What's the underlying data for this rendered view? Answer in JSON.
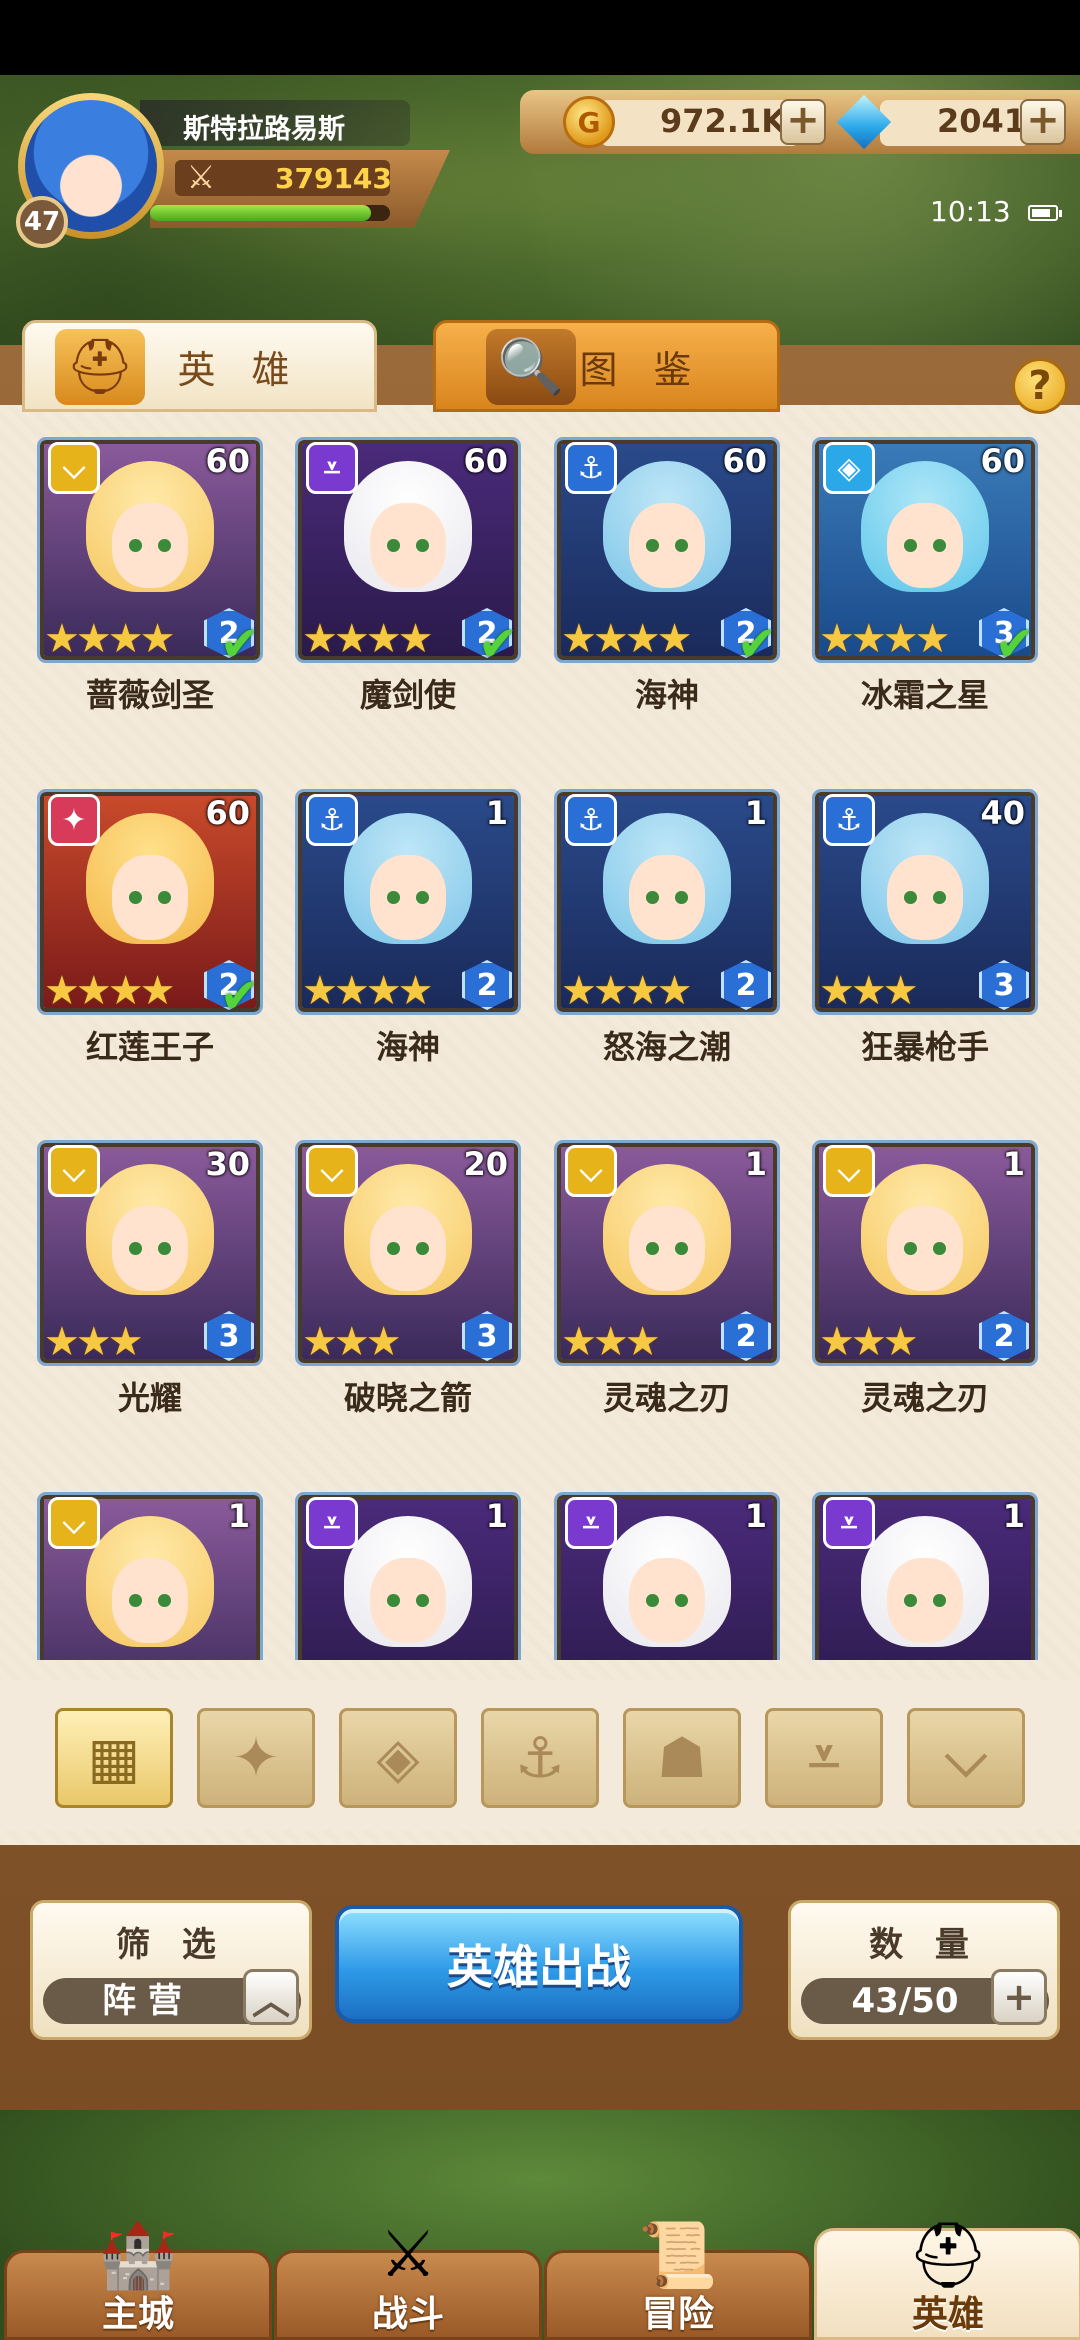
{
  "player": {
    "name": "斯特拉路易斯",
    "level": "47",
    "power": "379143",
    "exp_fraction": 0.92
  },
  "currency": {
    "gold": "972.1K",
    "gems": "2041",
    "plus": "+"
  },
  "status": {
    "time": "10:13"
  },
  "tabs": {
    "heroes": "英 雄",
    "codex": "图 鉴"
  },
  "help": "?",
  "heroes": [
    {
      "name": "蔷薇剑圣",
      "level": "60",
      "stars": "★★★★",
      "rank": "2",
      "checked": true,
      "faction": "light"
    },
    {
      "name": "魔剑使",
      "level": "60",
      "stars": "★★★★",
      "rank": "2",
      "checked": true,
      "faction": "dark"
    },
    {
      "name": "海神",
      "level": "60",
      "stars": "★★★★",
      "rank": "2",
      "checked": true,
      "faction": "sea"
    },
    {
      "name": "冰霜之星",
      "level": "60",
      "stars": "★★★★",
      "rank": "3",
      "checked": true,
      "faction": "ice"
    },
    {
      "name": "红莲王子",
      "level": "60",
      "stars": "★★★★",
      "rank": "2",
      "checked": true,
      "faction": "fire"
    },
    {
      "name": "海神",
      "level": "1",
      "stars": "★★★★",
      "rank": "2",
      "checked": false,
      "faction": "sea"
    },
    {
      "name": "怒海之潮",
      "level": "1",
      "stars": "★★★★",
      "rank": "2",
      "checked": false,
      "faction": "sea"
    },
    {
      "name": "狂暴枪手",
      "level": "40",
      "stars": "★★★",
      "rank": "3",
      "checked": false,
      "faction": "sea"
    },
    {
      "name": "光耀",
      "level": "30",
      "stars": "★★★",
      "rank": "3",
      "checked": false,
      "faction": "light"
    },
    {
      "name": "破晓之箭",
      "level": "20",
      "stars": "★★★",
      "rank": "3",
      "checked": false,
      "faction": "light"
    },
    {
      "name": "灵魂之刃",
      "level": "1",
      "stars": "★★★",
      "rank": "2",
      "checked": false,
      "faction": "light"
    },
    {
      "name": "灵魂之刃",
      "level": "1",
      "stars": "★★★",
      "rank": "2",
      "checked": false,
      "faction": "light"
    },
    {
      "name": "",
      "level": "1",
      "stars": "",
      "rank": "",
      "checked": false,
      "faction": "light"
    },
    {
      "name": "",
      "level": "1",
      "stars": "",
      "rank": "",
      "checked": false,
      "faction": "dark"
    },
    {
      "name": "",
      "level": "1",
      "stars": "",
      "rank": "",
      "checked": false,
      "faction": "dark"
    },
    {
      "name": "",
      "level": "1",
      "stars": "",
      "rank": "",
      "checked": false,
      "faction": "dark"
    }
  ],
  "filters": [
    {
      "icon": "grid-all-icon",
      "active": true
    },
    {
      "icon": "fire-faction-icon",
      "active": false
    },
    {
      "icon": "ice-faction-icon",
      "active": false
    },
    {
      "icon": "sea-faction-icon",
      "active": false
    },
    {
      "icon": "beast-faction-icon",
      "active": false
    },
    {
      "icon": "dark-faction-icon",
      "active": false
    },
    {
      "icon": "light-faction-icon",
      "active": false
    }
  ],
  "controls": {
    "filter_title": "筛 选",
    "filter_value": "阵 营",
    "deploy": "英雄出战",
    "count_title": "数 量",
    "count_value": "43/50"
  },
  "nav": [
    {
      "label": "主城",
      "icon": "city-icon",
      "active": false
    },
    {
      "label": "战斗",
      "icon": "crossed-swords-icon",
      "active": false
    },
    {
      "label": "冒险",
      "icon": "scroll-map-icon",
      "active": false
    },
    {
      "label": "英雄",
      "icon": "hero-helmet-icon",
      "active": true
    }
  ],
  "colors": {
    "faction_light": "#e6b41a",
    "faction_dark": "#7a3ad0",
    "faction_sea": "#2a6fd6",
    "faction_ice": "#2aa8e8",
    "faction_fire": "#d83a5a"
  }
}
